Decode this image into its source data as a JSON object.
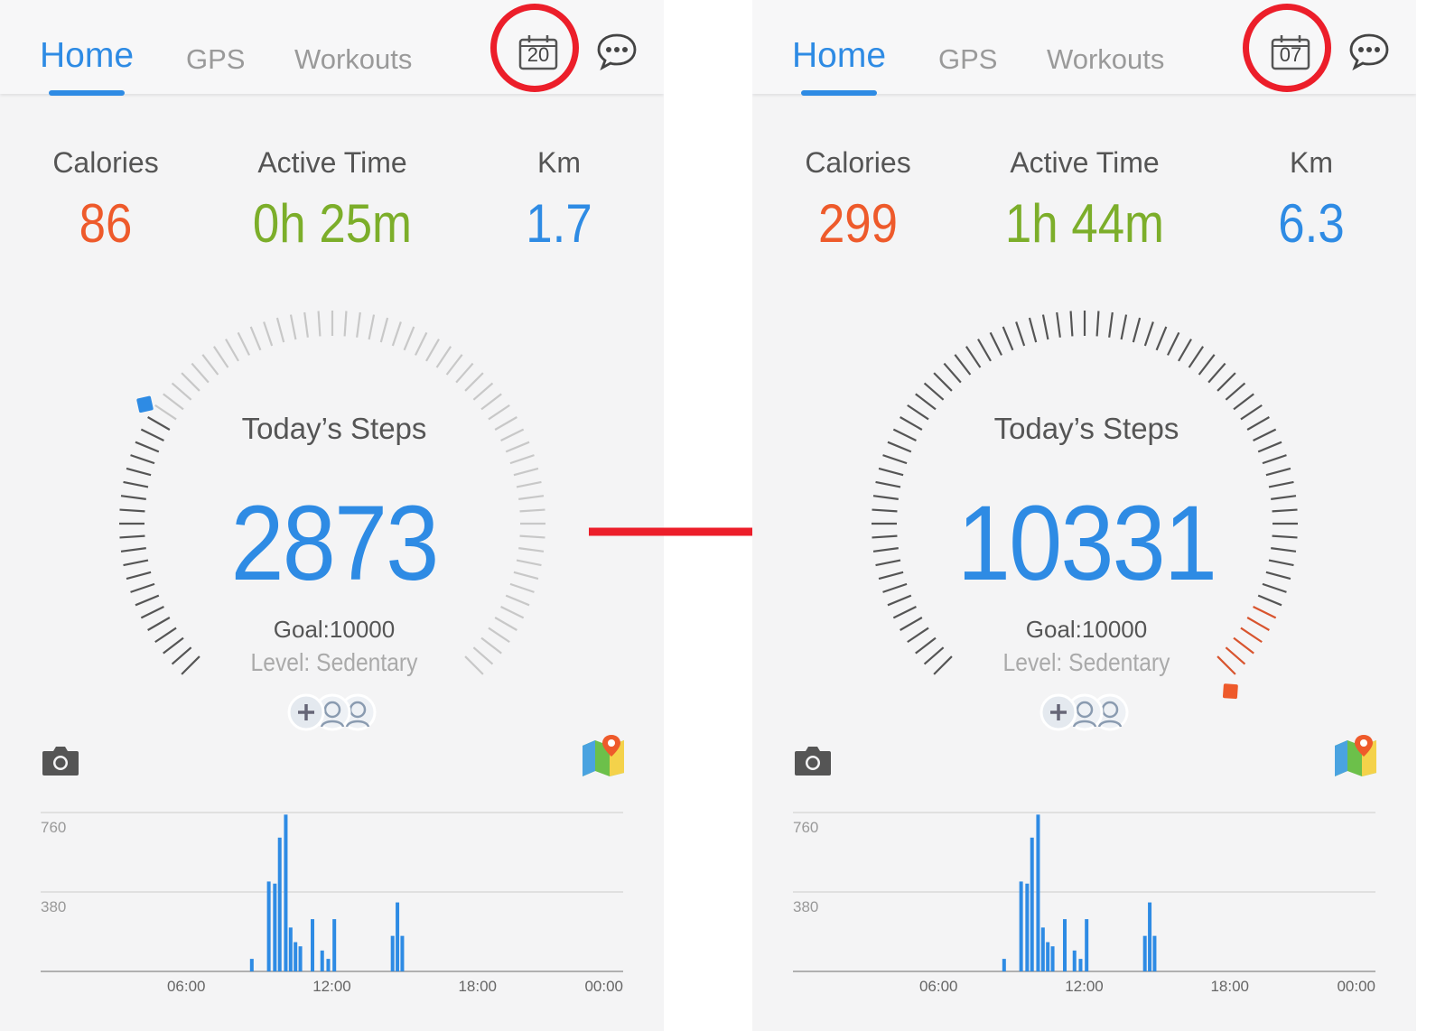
{
  "panels": [
    {
      "tabs": {
        "home": "Home",
        "gps": "GPS",
        "workouts": "Workouts"
      },
      "calendar_day": "20",
      "stats": {
        "calories_label": "Calories",
        "calories_value": "86",
        "active_label": "Active Time",
        "active_value": "0h 25m",
        "km_label": "Km",
        "km_value": "1.7"
      },
      "steps": {
        "title": "Today’s Steps",
        "value": "2873",
        "goal": "Goal:10000",
        "level": "Level: Sedentary",
        "progress": 0.287
      },
      "chart": {
        "y_ticks": [
          "760",
          "380"
        ],
        "x_ticks": [
          "06:00",
          "12:00",
          "18:00",
          "00:00"
        ]
      }
    },
    {
      "tabs": {
        "home": "Home",
        "gps": "GPS",
        "workouts": "Workouts"
      },
      "calendar_day": "07",
      "stats": {
        "calories_label": "Calories",
        "calories_value": "299",
        "active_label": "Active Time",
        "active_value": "1h 44m",
        "km_label": "Km",
        "km_value": "6.3"
      },
      "steps": {
        "title": "Today’s Steps",
        "value": "10331",
        "goal": "Goal:10000",
        "level": "Level: Sedentary",
        "progress": 1.0
      },
      "chart": {
        "y_ticks": [
          "760",
          "380"
        ],
        "x_ticks": [
          "06:00",
          "12:00",
          "18:00",
          "00:00"
        ]
      }
    }
  ],
  "chart_data": {
    "type": "bar",
    "ylim": [
      0,
      760
    ],
    "x_range_hours": [
      0,
      24
    ],
    "bars_hours": [
      8.7,
      9.4,
      9.65,
      9.85,
      10.1,
      10.3,
      10.5,
      10.7,
      11.2,
      11.6,
      11.85,
      12.1,
      14.5,
      14.7,
      14.9
    ],
    "values": [
      60,
      430,
      420,
      640,
      750,
      210,
      140,
      120,
      250,
      100,
      60,
      250,
      170,
      330,
      170
    ]
  },
  "colors": {
    "accent_blue": "#2e8be4",
    "calories_orange": "#ee5a2b",
    "active_green": "#7cae2a",
    "highlight_red": "#ec1e2a"
  },
  "icons": {
    "calendar": "calendar-icon",
    "chat": "chat-bubble-icon",
    "camera": "camera-icon",
    "map": "map-pin-icon",
    "friends": "add-friends-icon"
  }
}
